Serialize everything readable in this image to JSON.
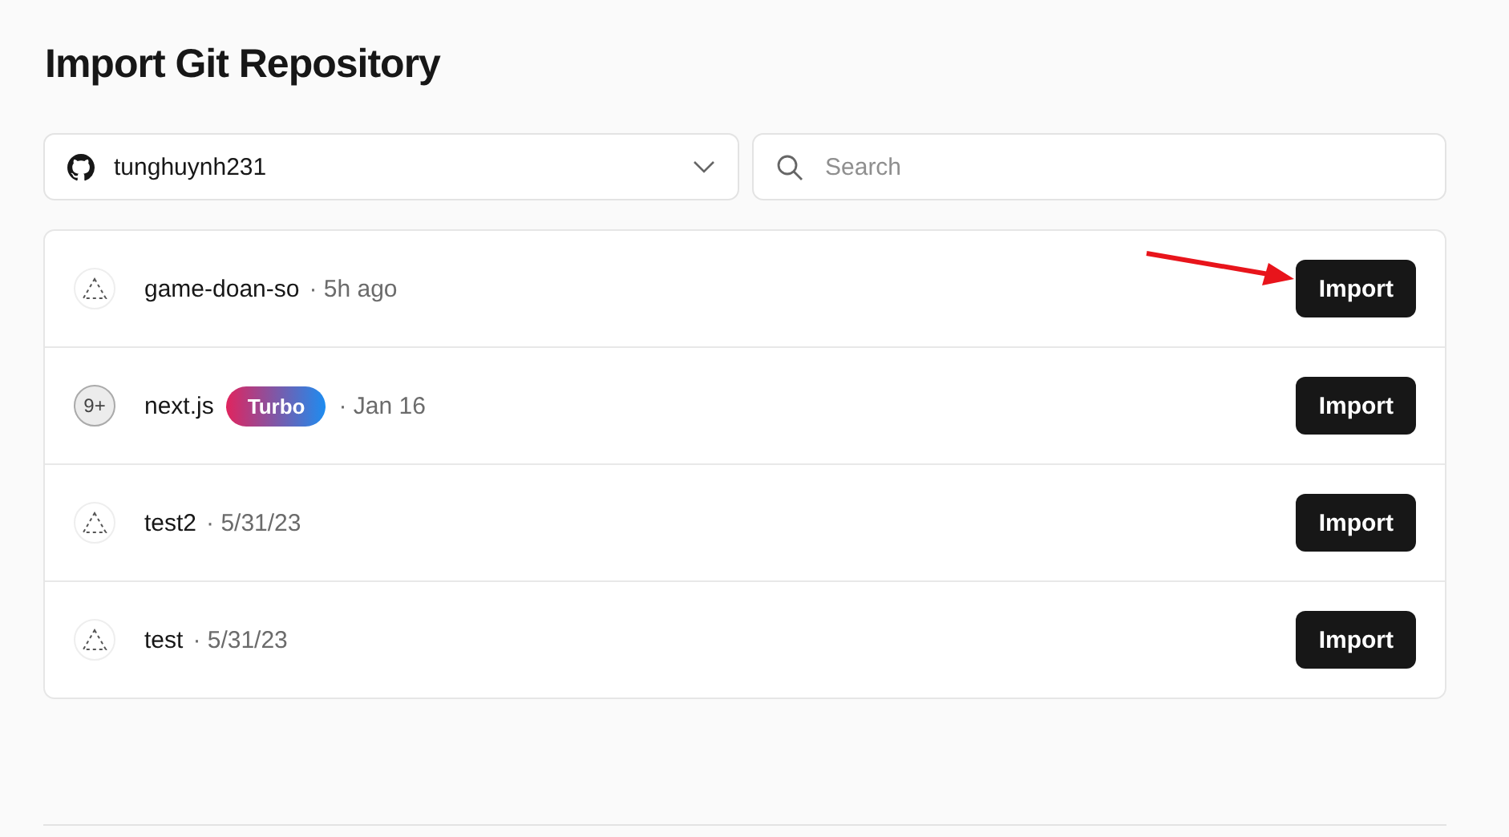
{
  "title": "Import Git Repository",
  "account_select": {
    "value": "tunghuynh231"
  },
  "search": {
    "placeholder": "Search"
  },
  "repositories": [
    {
      "name": "game-doan-so",
      "icon": {
        "kind": "placeholder"
      },
      "meta": "· 5h ago",
      "action": "Import",
      "annotated": true
    },
    {
      "name": "next.js",
      "icon": {
        "kind": "count",
        "text": "9+"
      },
      "badge": "Turbo",
      "meta": "· Jan 16",
      "action": "Import",
      "annotated": false
    },
    {
      "name": "test2",
      "icon": {
        "kind": "placeholder"
      },
      "meta": "· 5/31/23",
      "action": "Import",
      "annotated": false
    },
    {
      "name": "test",
      "icon": {
        "kind": "placeholder"
      },
      "meta": "· 5/31/23",
      "action": "Import",
      "annotated": false
    }
  ]
}
